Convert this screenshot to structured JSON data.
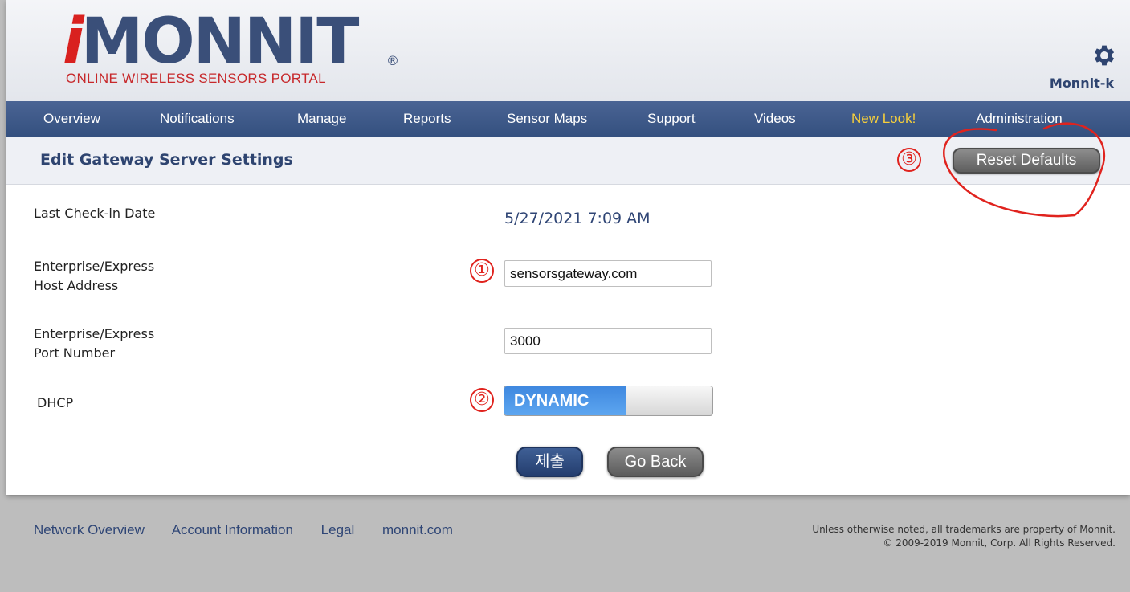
{
  "header": {
    "logo_prefix": "i",
    "logo_text": "MONNIT",
    "logo_registered": "®",
    "logo_tagline": "ONLINE WIRELESS SENSORS PORTAL",
    "account_name": "Monnit-k"
  },
  "nav": {
    "items": [
      {
        "label": "Overview"
      },
      {
        "label": "Notifications"
      },
      {
        "label": "Manage"
      },
      {
        "label": "Reports"
      },
      {
        "label": "Sensor Maps"
      },
      {
        "label": "Support"
      },
      {
        "label": "Videos"
      },
      {
        "label": "New Look!"
      },
      {
        "label": "Administration"
      }
    ]
  },
  "subheader": {
    "title": "Edit Gateway Server Settings",
    "reset_button": "Reset Defaults"
  },
  "annotations": {
    "marker_1": "①",
    "marker_2": "②",
    "marker_3": "③",
    "highlight_color": "#e0231e"
  },
  "form": {
    "checkin_label": "Last Check-in Date",
    "checkin_value": "5/27/2021 7:09 AM",
    "host_label_line1": "Enterprise/Express",
    "host_label_line2": "Host Address",
    "host_value": "sensorsgateway.com",
    "port_label_line1": "Enterprise/Express",
    "port_label_line2": "Port Number",
    "port_value": "3000",
    "dhcp_label": "DHCP",
    "dhcp_state": "DYNAMIC",
    "submit_button": "제출",
    "back_button": "Go Back"
  },
  "footer": {
    "links": [
      "Network Overview",
      "Account Information",
      "Legal",
      "monnit.com"
    ],
    "legal_line1": "Unless otherwise noted, all trademarks are property of Monnit.",
    "legal_line2": "© 2009-2019 Monnit, Corp. All Rights Reserved."
  },
  "colors": {
    "brand_blue": "#34507f",
    "brand_red": "#d9211f",
    "nav_highlight": "#f6cf3c"
  }
}
